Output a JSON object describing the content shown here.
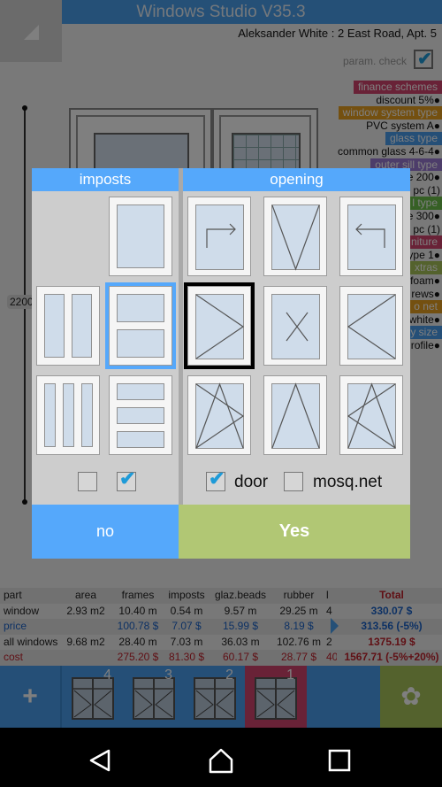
{
  "app": {
    "title": "Windows Studio V35.3",
    "client": "Aleksander White : 2 East Road, Apt. 5",
    "param_check_label": "param. check",
    "param_check_checked": true,
    "dimension_label": "2200"
  },
  "specs": [
    {
      "tag": "finance schemes",
      "color": "#d3446e",
      "value": "discount 5%●"
    },
    {
      "tag": "window system type",
      "color": "#e8a020",
      "value": "PVC system A●"
    },
    {
      "tag": "glass type",
      "color": "#4a9eef",
      "value": "common glass 4-6-4●"
    },
    {
      "tag": "outer sill type",
      "color": "#9b7bd4",
      "value": "e 200●"
    },
    {
      "tag": "",
      "color": "",
      "value": "pc (1)"
    },
    {
      "tag": "l type",
      "color": "#6cc04a",
      "value": "e 300●"
    },
    {
      "tag": "",
      "color": "",
      "value": "pc (1)"
    },
    {
      "tag": "niture",
      "color": "#d3446e",
      "value": "ype 1●"
    },
    {
      "tag": "xtras",
      "color": "#a8c55a",
      "value": "foam●"
    },
    {
      "tag": "",
      "color": "",
      "value": "rews●"
    },
    {
      "tag": "o net",
      "color": "#e8a020",
      "value": "white●"
    },
    {
      "tag": "y size",
      "color": "#4a9eef",
      "value": "rofile●"
    }
  ],
  "dialog": {
    "imposts": {
      "title": "imposts",
      "options": [
        "single",
        "vertical-2",
        "horizontal-2",
        "vertical-3",
        "horizontal-3"
      ],
      "selected": "horizontal-2",
      "checkbox1_checked": false,
      "checkbox2_checked": true
    },
    "opening": {
      "title": "opening",
      "options": [
        "sliding-right",
        "bottom-hung-inverted",
        "sliding-left",
        "side-hung-right",
        "fixed",
        "side-hung-left",
        "tilt-turn-right",
        "top-tilt",
        "tilt-turn-left"
      ],
      "selected": "side-hung-right",
      "door_label": "door",
      "door_checked": true,
      "mosq_label": "mosq.net",
      "mosq_checked": false
    },
    "no_label": "no",
    "yes_label": "Yes"
  },
  "table": {
    "headers": [
      "part",
      "area",
      "frames",
      "imposts",
      "glaz.beads",
      "rubber",
      "l",
      "Total"
    ],
    "rows": [
      {
        "style": "dark",
        "cells": [
          "window",
          "2.93 m2",
          "10.40 m",
          "0.54 m",
          "9.57 m",
          "29.25 m",
          "4",
          "330.07 $"
        ],
        "total_style": "blue"
      },
      {
        "style": "blue",
        "cells": [
          "price",
          "",
          "100.78 $",
          "7.07 $",
          "15.99 $",
          "8.19 $",
          "",
          "313.56 (-5%)"
        ],
        "total_style": "blue"
      },
      {
        "style": "dark",
        "cells": [
          "all windows",
          "9.68 m2",
          "28.40 m",
          "7.03 m",
          "36.03 m",
          "102.76 m",
          "2",
          "1375.19 $"
        ],
        "total_style": "red"
      },
      {
        "style": "red",
        "cells": [
          "cost",
          "",
          "275.20 $",
          "81.30 $",
          "60.17 $",
          "28.77 $",
          "40",
          "1567.71 (-5%+20%)"
        ],
        "total_style": "red"
      }
    ]
  },
  "bottombar": {
    "add_label": "+",
    "thumbnails": [
      {
        "number": "4",
        "active": false
      },
      {
        "number": "3",
        "active": false
      },
      {
        "number": "2",
        "active": false
      },
      {
        "number": "1",
        "active": true
      }
    ],
    "flower_label": "✿"
  }
}
